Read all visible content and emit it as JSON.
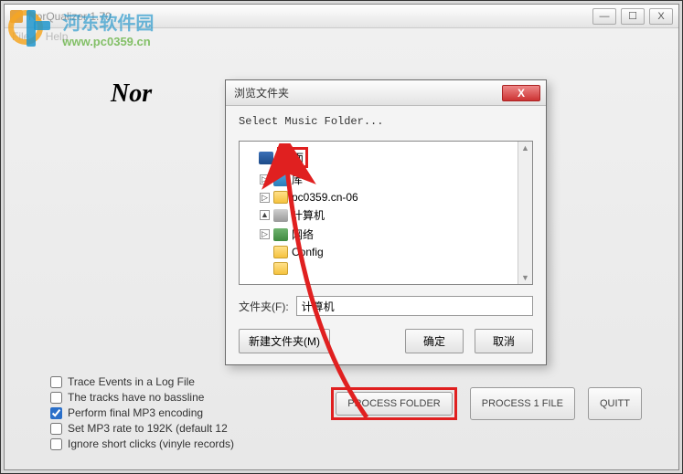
{
  "window": {
    "title": "NorQualizer 1.70",
    "menus": [
      "File",
      "Help"
    ],
    "controls": {
      "min": "—",
      "max": "☐",
      "close": "X"
    }
  },
  "watermark": {
    "site_name": "河东软件园",
    "url": "www.pc0359.cn"
  },
  "heading_partial": "Nor",
  "checkboxes": [
    {
      "label": "Trace Events in a Log File",
      "checked": false
    },
    {
      "label": "The tracks have no bassline",
      "checked": false
    },
    {
      "label": "Perform final MP3 encoding",
      "checked": true
    },
    {
      "label": "Set MP3 rate to 192K (default 12",
      "checked": false
    },
    {
      "label": "Ignore short clicks (vinyle records)",
      "checked": false
    }
  ],
  "buttons": {
    "process_folder": "PROCESS FOLDER",
    "process_file": "PROCESS 1 FILE",
    "quit": "QUITT"
  },
  "dialog": {
    "title": "浏览文件夹",
    "close": "X",
    "prompt": "Select Music Folder...",
    "tree": [
      {
        "label": "桌面",
        "icon": "desktop",
        "expander": "",
        "indent": 0,
        "highlighted": true
      },
      {
        "label": "库",
        "icon": "lib",
        "expander": "▷",
        "indent": 1
      },
      {
        "label": "pc0359.cn-06",
        "icon": "folder",
        "expander": "▷",
        "indent": 1
      },
      {
        "label": "计算机",
        "icon": "computer",
        "expander": "▲",
        "indent": 1
      },
      {
        "label": "网络",
        "icon": "network",
        "expander": "▷",
        "indent": 1
      },
      {
        "label": "Config",
        "icon": "folder",
        "expander": "",
        "indent": 1
      },
      {
        "label": "",
        "icon": "folder",
        "expander": "",
        "indent": 1
      }
    ],
    "folder_label": "文件夹(F):",
    "folder_value": "计算机",
    "new_folder": "新建文件夹(M)",
    "ok": "确定",
    "cancel": "取消"
  }
}
